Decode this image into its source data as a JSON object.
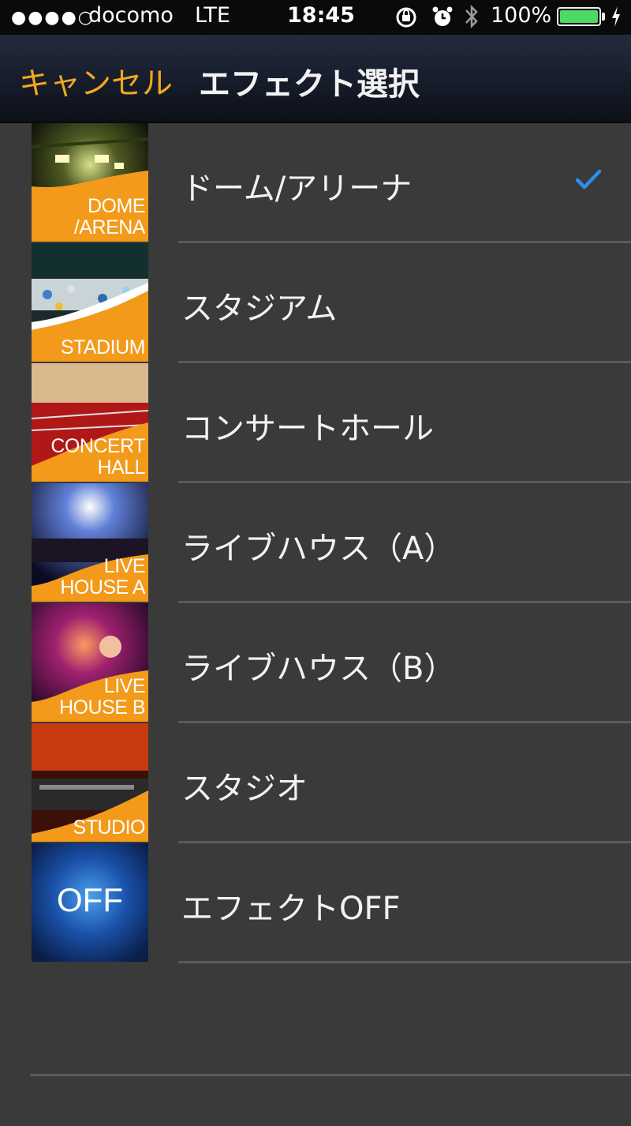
{
  "status": {
    "signal": "●●●●○",
    "carrier": "docomo",
    "network": "LTE",
    "time": "18:45",
    "battery": "100%"
  },
  "nav": {
    "cancel_label": "キャンセル",
    "title": "エフェクト選択"
  },
  "colors": {
    "accent": "#f0a81e",
    "check": "#2f8cf0",
    "background": "#3a3a3a"
  },
  "effects": [
    {
      "label": "ドーム/アリーナ",
      "thumb": "DOME\n/ARENA",
      "selected": true
    },
    {
      "label": "スタジアム",
      "thumb": "STADIUM",
      "selected": false
    },
    {
      "label": "コンサートホール",
      "thumb": "CONCERT\nHALL",
      "selected": false
    },
    {
      "label": "ライブハウス（A）",
      "thumb": "LIVE\nHOUSE A",
      "selected": false
    },
    {
      "label": "ライブハウス（B）",
      "thumb": "LIVE\nHOUSE B",
      "selected": false
    },
    {
      "label": "スタジオ",
      "thumb": "STUDIO",
      "selected": false
    },
    {
      "label": "エフェクトOFF",
      "thumb": "OFF",
      "selected": false
    }
  ]
}
